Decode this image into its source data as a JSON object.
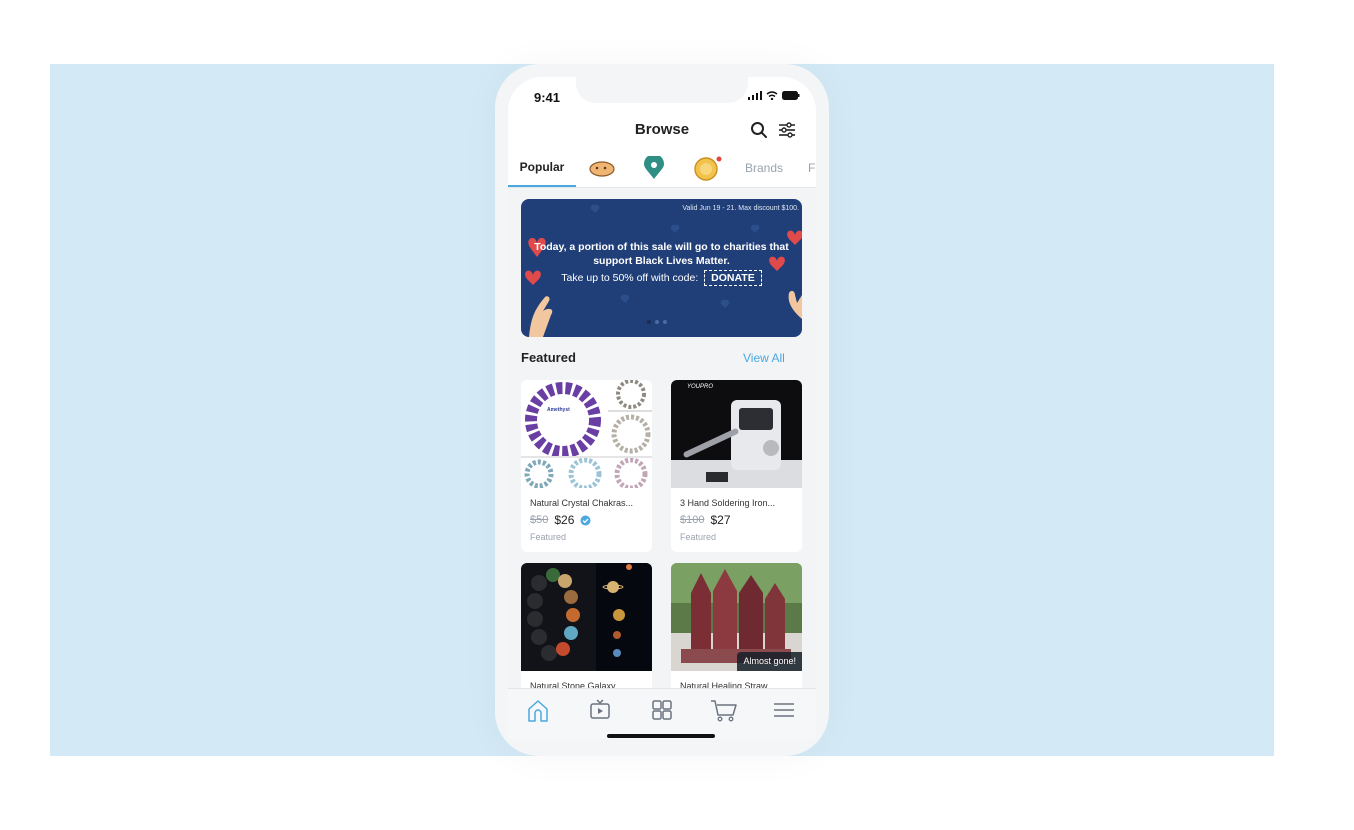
{
  "status": {
    "time": "9:41"
  },
  "header": {
    "title": "Browse"
  },
  "tabs": {
    "popular": "Popular",
    "brands": "Brands",
    "more": "F"
  },
  "banner": {
    "valid": "Valid Jun 19 - 21. Max discount $100.",
    "line1": "Today, a portion of this sale will go to charities that",
    "line2": "support Black Lives Matter.",
    "line3": "Take up to 50% off with code:",
    "code": "DONATE",
    "bg_color": "#203f79"
  },
  "featured": {
    "title": "Featured",
    "view_all": "View All"
  },
  "products": [
    {
      "name": "Natural Crystal Chakras...",
      "old_price": "$50",
      "price": "$26",
      "tag": "Featured",
      "img_text": "Amethyst"
    },
    {
      "name": "3 Hand Soldering Iron...",
      "old_price": "$100",
      "price": "$27",
      "tag": "Featured",
      "img_text": "YOUPRO"
    },
    {
      "name": "Natural Stone Galaxy ..."
    },
    {
      "name": "Natural Healing Straw...",
      "badge": "Almost gone!"
    }
  ],
  "accent_color": "#4aa8e0"
}
